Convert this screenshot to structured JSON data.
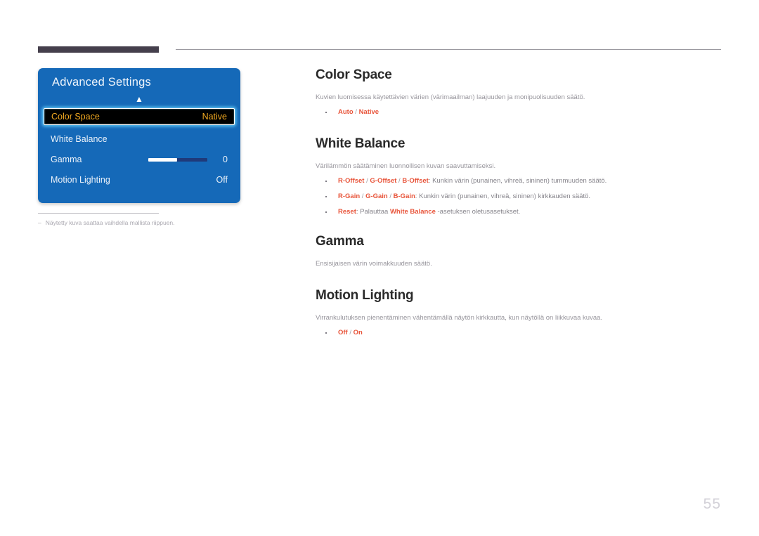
{
  "page": {
    "number": "55"
  },
  "osd": {
    "title": "Advanced Settings",
    "chevron_icon": "chevron-up-icon",
    "rows": [
      {
        "label": "Color Space",
        "value": "Native",
        "selected": true
      },
      {
        "label": "White Balance",
        "value": "",
        "selected": false
      },
      {
        "label": "Gamma",
        "value": "0",
        "selected": false,
        "slider_percent": 49
      },
      {
        "label": "Motion Lighting",
        "value": "Off",
        "selected": false
      }
    ],
    "footnote": {
      "dash": "–",
      "text": "Näytetty kuva saattaa vaihdella mallista riippuen."
    }
  },
  "sections": [
    {
      "id": "colorspace",
      "heading": "Color Space",
      "description": "Kuvien luomisessa käytettävien värien (värimaailman) laajuuden ja monipuolisuuden säätö.",
      "bullets": [
        {
          "parts": [
            {
              "text": "Auto",
              "style": "accent"
            },
            {
              "text": " / ",
              "style": "sep"
            },
            {
              "text": "Native",
              "style": "accent"
            }
          ]
        }
      ]
    },
    {
      "id": "whitebalance",
      "heading": "White Balance",
      "description": "Värilämmön säätäminen luonnollisen kuvan saavuttamiseksi.",
      "bullets": [
        {
          "parts": [
            {
              "text": "R-Offset",
              "style": "accent"
            },
            {
              "text": " / ",
              "style": "sep"
            },
            {
              "text": "G-Offset",
              "style": "accent"
            },
            {
              "text": " / ",
              "style": "sep"
            },
            {
              "text": "B-Offset",
              "style": "accent"
            },
            {
              "text": ": Kunkin värin (punainen, vihreä, sininen) tummuuden säätö.",
              "style": "plain"
            }
          ]
        },
        {
          "parts": [
            {
              "text": "R-Gain",
              "style": "accent"
            },
            {
              "text": " / ",
              "style": "sep"
            },
            {
              "text": "G-Gain",
              "style": "accent"
            },
            {
              "text": " / ",
              "style": "sep"
            },
            {
              "text": "B-Gain",
              "style": "accent"
            },
            {
              "text": ": Kunkin värin (punainen, vihreä, sininen) kirkkauden säätö.",
              "style": "plain"
            }
          ]
        },
        {
          "parts": [
            {
              "text": "Reset",
              "style": "accent"
            },
            {
              "text": ": Palauttaa ",
              "style": "plain"
            },
            {
              "text": "White Balance",
              "style": "accent"
            },
            {
              "text": " -asetuksen oletusasetukset.",
              "style": "plain"
            }
          ]
        }
      ]
    },
    {
      "id": "gamma",
      "heading": "Gamma",
      "description": "Ensisijaisen värin voimakkuuden säätö.",
      "bullets": []
    },
    {
      "id": "motionlighting",
      "heading": "Motion Lighting",
      "description": "Virrankulutuksen pienentäminen vähentämällä näytön kirkkautta, kun näytöllä on liikkuvaa kuvaa.",
      "bullets": [
        {
          "parts": [
            {
              "text": "Off",
              "style": "accent"
            },
            {
              "text": " / ",
              "style": "sep"
            },
            {
              "text": "On",
              "style": "accent"
            }
          ]
        }
      ]
    }
  ],
  "colors": {
    "osd_panel_blue": "#1569b8",
    "osd_selected_row_bg": "#000000",
    "osd_selected_text": "#f0a821",
    "osd_glow": "#6ed7ff",
    "accent_orange": "#e8543a",
    "heading_gray": "#2a2a2a",
    "body_gray": "#97959c",
    "header_bar_dark": "#453f4c",
    "page_number_gray": "#d3d1d8"
  }
}
